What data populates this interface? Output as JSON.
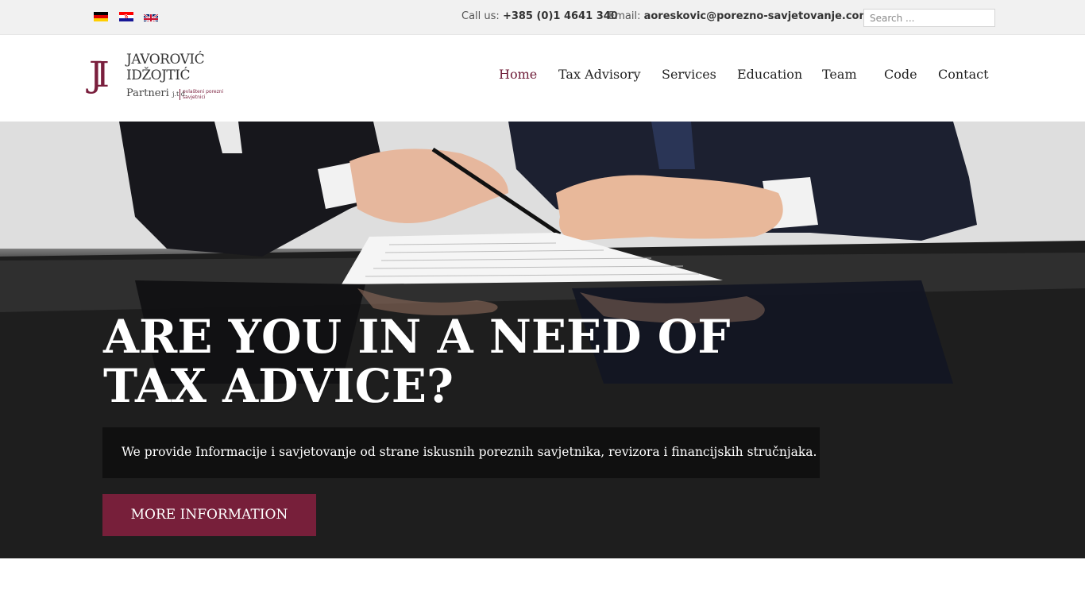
{
  "topbar": {
    "languages": [
      {
        "name": "German",
        "icon": "flag-de-icon"
      },
      {
        "name": "Croatian",
        "icon": "flag-hr-icon"
      },
      {
        "name": "English",
        "icon": "flag-gb-icon"
      }
    ],
    "phone_label": "Call us:",
    "phone_value": "+385 (0)1 4641 340",
    "email_label": "Email:",
    "email_value": "aoreskovic@porezno-savjetovanje.com.hr",
    "search_placeholder": "Search ..."
  },
  "logo": {
    "monogram": "JI",
    "line1": "JAVOROVIĆ",
    "line2": "IDŽOJTIĆ",
    "line3": "Partneri",
    "line3_suffix": "j.t.d.",
    "sub": "ovlašteni porezni savjetnici"
  },
  "nav": {
    "items": [
      "Home",
      "Tax Advisory",
      "Services",
      "Education",
      "Team",
      "Code",
      "Contact"
    ],
    "active": "Home"
  },
  "hero": {
    "title_line1": "ARE YOU IN A NEED OF",
    "title_line2": "TAX ADVICE?",
    "text": "We provide Informacije i savjetovanje od strane iskusnih poreznih savjetnika, revizora i financijskih stručnjaka.",
    "button_label": "MORE INFORMATION"
  },
  "colors": {
    "accent": "#771f3a",
    "nav_active": "#6d1a36",
    "topbar_bg": "#f1f1f1"
  }
}
